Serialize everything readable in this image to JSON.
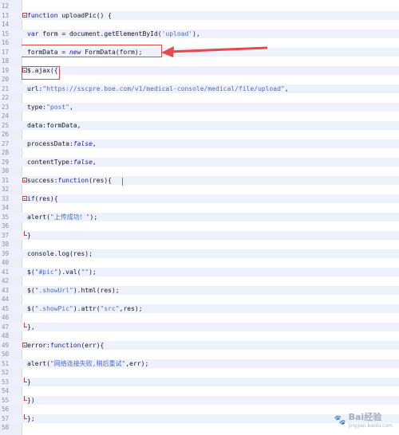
{
  "editor": {
    "lines": [
      {
        "n": "12",
        "code": [
          {
            "t": "",
            "c": "id"
          }
        ]
      },
      {
        "n": "13",
        "code": [
          {
            "t": "function",
            "c": "kw"
          },
          {
            "t": " uploadPic() {",
            "c": "id"
          }
        ]
      },
      {
        "n": "14",
        "code": [
          {
            "t": "",
            "c": "id"
          }
        ]
      },
      {
        "n": "15",
        "code": [
          {
            "t": "var",
            "c": "kw"
          },
          {
            "t": " form = document.getElementById(",
            "c": "id"
          },
          {
            "t": "'upload'",
            "c": "str"
          },
          {
            "t": "),",
            "c": "id"
          }
        ]
      },
      {
        "n": "16",
        "code": [
          {
            "t": "",
            "c": "id"
          }
        ]
      },
      {
        "n": "17",
        "code": [
          {
            "t": "formData = ",
            "c": "id"
          },
          {
            "t": "new",
            "c": "kwi"
          },
          {
            "t": " FormData(form);",
            "c": "id"
          }
        ]
      },
      {
        "n": "18",
        "code": [
          {
            "t": "",
            "c": "id"
          }
        ]
      },
      {
        "n": "19",
        "code": [
          {
            "t": "$.ajax({",
            "c": "id"
          }
        ]
      },
      {
        "n": "20",
        "code": [
          {
            "t": "",
            "c": "id"
          }
        ]
      },
      {
        "n": "21",
        "code": [
          {
            "t": "url:",
            "c": "id"
          },
          {
            "t": "\"https://sscpre.boe.com/v1/medical-console/medical/file/upload\"",
            "c": "str"
          },
          {
            "t": ",",
            "c": "id"
          }
        ]
      },
      {
        "n": "22",
        "code": [
          {
            "t": "",
            "c": "id"
          }
        ]
      },
      {
        "n": "23",
        "code": [
          {
            "t": "type:",
            "c": "id"
          },
          {
            "t": "\"post\"",
            "c": "str"
          },
          {
            "t": ",",
            "c": "id"
          }
        ]
      },
      {
        "n": "24",
        "code": [
          {
            "t": "",
            "c": "id"
          }
        ]
      },
      {
        "n": "25",
        "code": [
          {
            "t": "data:formData,",
            "c": "id"
          }
        ]
      },
      {
        "n": "26",
        "code": [
          {
            "t": "",
            "c": "id"
          }
        ]
      },
      {
        "n": "27",
        "code": [
          {
            "t": "processData:",
            "c": "id"
          },
          {
            "t": "false",
            "c": "kwi"
          },
          {
            "t": ",",
            "c": "id"
          }
        ]
      },
      {
        "n": "28",
        "code": [
          {
            "t": "",
            "c": "id"
          }
        ]
      },
      {
        "n": "29",
        "code": [
          {
            "t": "contentType:",
            "c": "id"
          },
          {
            "t": "false",
            "c": "kwi"
          },
          {
            "t": ",",
            "c": "id"
          }
        ]
      },
      {
        "n": "30",
        "code": [
          {
            "t": "",
            "c": "id"
          }
        ]
      },
      {
        "n": "31",
        "code": [
          {
            "t": "success:",
            "c": "id"
          },
          {
            "t": "function",
            "c": "kw"
          },
          {
            "t": "(res){",
            "c": "id"
          }
        ]
      },
      {
        "n": "32",
        "code": [
          {
            "t": "",
            "c": "id"
          }
        ]
      },
      {
        "n": "33",
        "code": [
          {
            "t": "if",
            "c": "kw"
          },
          {
            "t": "(res){",
            "c": "id"
          }
        ]
      },
      {
        "n": "34",
        "code": [
          {
            "t": "",
            "c": "id"
          }
        ]
      },
      {
        "n": "35",
        "code": [
          {
            "t": "alert(",
            "c": "id"
          },
          {
            "t": "\"上传成功！\"",
            "c": "str"
          },
          {
            "t": ");",
            "c": "id"
          }
        ]
      },
      {
        "n": "36",
        "code": [
          {
            "t": "",
            "c": "id"
          }
        ]
      },
      {
        "n": "37",
        "code": [
          {
            "t": "}",
            "c": "id"
          }
        ]
      },
      {
        "n": "38",
        "code": [
          {
            "t": "",
            "c": "id"
          }
        ]
      },
      {
        "n": "39",
        "code": [
          {
            "t": "console.log(res);",
            "c": "id"
          }
        ]
      },
      {
        "n": "40",
        "code": [
          {
            "t": "",
            "c": "id"
          }
        ]
      },
      {
        "n": "41",
        "code": [
          {
            "t": "$(",
            "c": "id"
          },
          {
            "t": "\"#pic\"",
            "c": "str"
          },
          {
            "t": ").val(",
            "c": "id"
          },
          {
            "t": "\"\"",
            "c": "str"
          },
          {
            "t": ");",
            "c": "id"
          }
        ]
      },
      {
        "n": "42",
        "code": [
          {
            "t": "",
            "c": "id"
          }
        ]
      },
      {
        "n": "43",
        "code": [
          {
            "t": "$(",
            "c": "id"
          },
          {
            "t": "\".showUrl\"",
            "c": "str"
          },
          {
            "t": ").html(res);",
            "c": "id"
          }
        ]
      },
      {
        "n": "44",
        "code": [
          {
            "t": "",
            "c": "id"
          }
        ]
      },
      {
        "n": "45",
        "code": [
          {
            "t": "$(",
            "c": "id"
          },
          {
            "t": "\".showPic\"",
            "c": "str"
          },
          {
            "t": ").attr(",
            "c": "id"
          },
          {
            "t": "\"src\"",
            "c": "str"
          },
          {
            "t": ",res);",
            "c": "id"
          }
        ]
      },
      {
        "n": "46",
        "code": [
          {
            "t": "",
            "c": "id"
          }
        ]
      },
      {
        "n": "47",
        "code": [
          {
            "t": "},",
            "c": "id"
          }
        ]
      },
      {
        "n": "48",
        "code": [
          {
            "t": "",
            "c": "id"
          }
        ]
      },
      {
        "n": "49",
        "code": [
          {
            "t": "error:",
            "c": "id"
          },
          {
            "t": "function",
            "c": "kw"
          },
          {
            "t": "(err){",
            "c": "id"
          }
        ]
      },
      {
        "n": "50",
        "code": [
          {
            "t": "",
            "c": "id"
          }
        ]
      },
      {
        "n": "51",
        "code": [
          {
            "t": "alert(",
            "c": "id"
          },
          {
            "t": "\"网络连接失败,稍后重试\"",
            "c": "str"
          },
          {
            "t": ",err);",
            "c": "id"
          }
        ]
      },
      {
        "n": "52",
        "code": [
          {
            "t": "",
            "c": "id"
          }
        ]
      },
      {
        "n": "53",
        "code": [
          {
            "t": "}",
            "c": "id"
          }
        ]
      },
      {
        "n": "54",
        "code": [
          {
            "t": "",
            "c": "id"
          }
        ]
      },
      {
        "n": "55",
        "code": [
          {
            "t": "})",
            "c": "id"
          }
        ]
      },
      {
        "n": "56",
        "code": [
          {
            "t": "",
            "c": "id"
          }
        ]
      },
      {
        "n": "57",
        "code": [
          {
            "t": "};",
            "c": "id"
          }
        ]
      },
      {
        "n": "58",
        "code": [
          {
            "t": "",
            "c": "id"
          }
        ]
      }
    ],
    "fold_markers": {
      "13": "box",
      "19": "box",
      "31": "box",
      "33": "box",
      "49": "box",
      "37": "end",
      "47": "end",
      "53": "end",
      "55": "end",
      "57": "end"
    },
    "highlighted_lines": [
      "13",
      "15",
      "17",
      "19",
      "21",
      "23",
      "25",
      "27",
      "29",
      "31",
      "33",
      "35",
      "37",
      "39",
      "41",
      "43",
      "45",
      "47",
      "49",
      "51",
      "53",
      "55",
      "57"
    ]
  },
  "watermark": {
    "brand": "Bai",
    "brand2": "经验",
    "sub": "jingyan.baidu.com"
  },
  "colors": {
    "annotation": "#e34a4a",
    "keyword": "#1d1db0",
    "string": "#4a6fc2"
  }
}
